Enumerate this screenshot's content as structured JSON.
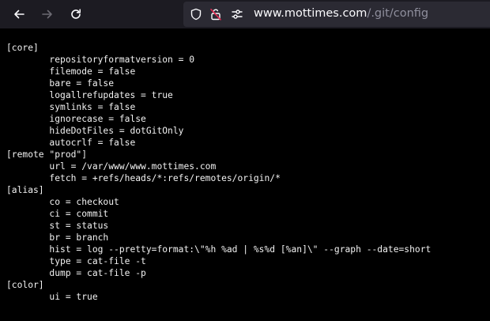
{
  "browser": {
    "url_host": "www.mottimes.com",
    "url_path": "/.git/config",
    "icons": {
      "back": "arrow-left-icon",
      "forward": "arrow-right-icon",
      "reload": "reload-icon",
      "shield": "shield-icon",
      "permission": "lock-off-icon",
      "site-info": "sliders-icon"
    }
  },
  "file_lines": [
    "[core]",
    "\trepositoryformatversion = 0",
    "\tfilemode = false",
    "\tbare = false",
    "\tlogallrefupdates = true",
    "\tsymlinks = false",
    "\tignorecase = false",
    "\thideDotFiles = dotGitOnly",
    "\tautocrlf = false",
    "[remote \"prod\"]",
    "\turl = /var/www/www.mottimes.com",
    "\tfetch = +refs/heads/*:refs/remotes/origin/*",
    "[alias]",
    "\tco = checkout",
    "\tci = commit",
    "\tst = status",
    "\tbr = branch",
    "\thist = log --pretty=format:\\\"%h %ad | %s%d [%an]\\\" --graph --date=short",
    "\ttype = cat-file -t",
    "\tdump = cat-file -p",
    "[color]",
    "\tui = true"
  ]
}
